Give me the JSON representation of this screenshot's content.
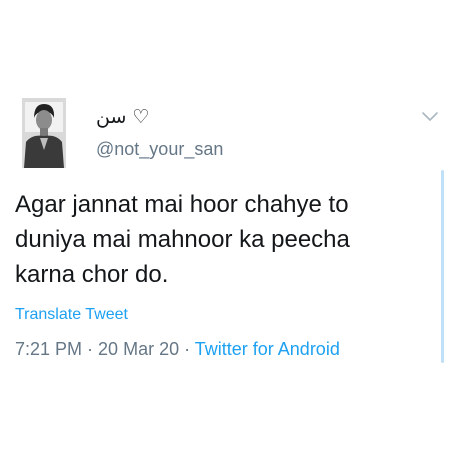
{
  "tweet": {
    "display_name": "سن ♡",
    "handle": "@not_your_san",
    "text_lines": [
      "Agar jannat mai hoor chahye to",
      "duniya mai mahnoor ka peecha",
      "karna chor do."
    ],
    "translate_label": "Translate Tweet",
    "time": "7:21 PM",
    "separator": " · ",
    "date": "20 Mar 20",
    "source": "Twitter for Android"
  },
  "icons": {
    "menu": "chevron-down-icon",
    "avatar": "user-avatar"
  },
  "colors": {
    "text": "#14171a",
    "secondary": "#657786",
    "link": "#1da1f2",
    "scroll": "#bfe0f7"
  }
}
